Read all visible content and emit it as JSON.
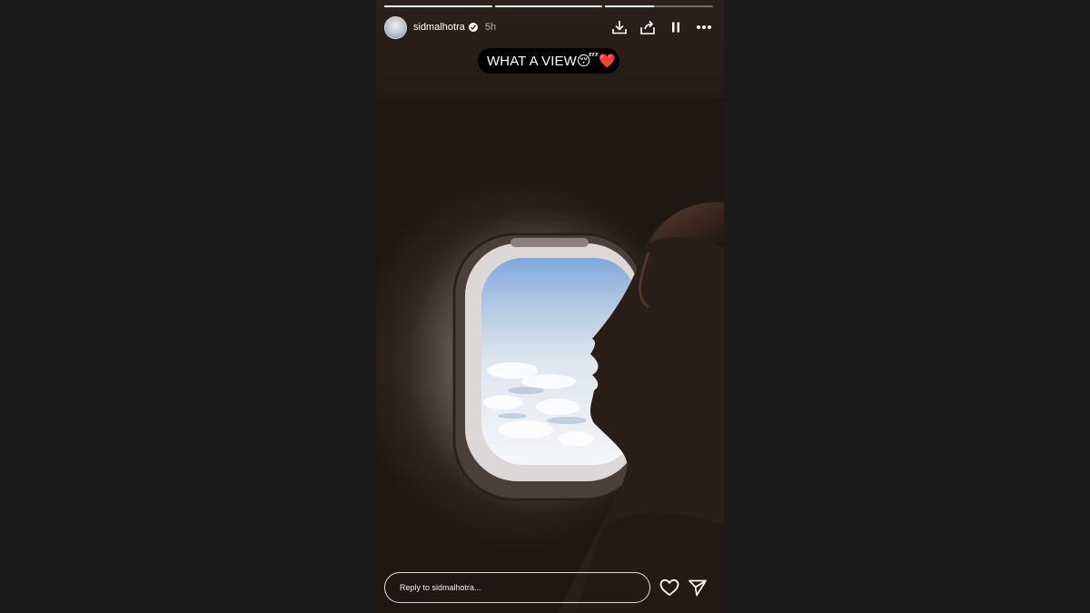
{
  "story": {
    "username": "sidmalhotra",
    "verified": true,
    "time": "5h",
    "progress": [
      1.0,
      1.0,
      0.45
    ],
    "caption": "WHAT A VIEW😴❤️",
    "reply_placeholder": "Reply to sidmalhotra..."
  },
  "icons": {
    "download": "download-icon",
    "share": "share-icon",
    "pause": "pause-icon",
    "more": "more-icon",
    "like": "heart-icon",
    "send": "send-icon"
  },
  "colors": {
    "background": "#1b1b1b",
    "story_bg": "#1f1712",
    "sky": "#8fb6e0"
  }
}
